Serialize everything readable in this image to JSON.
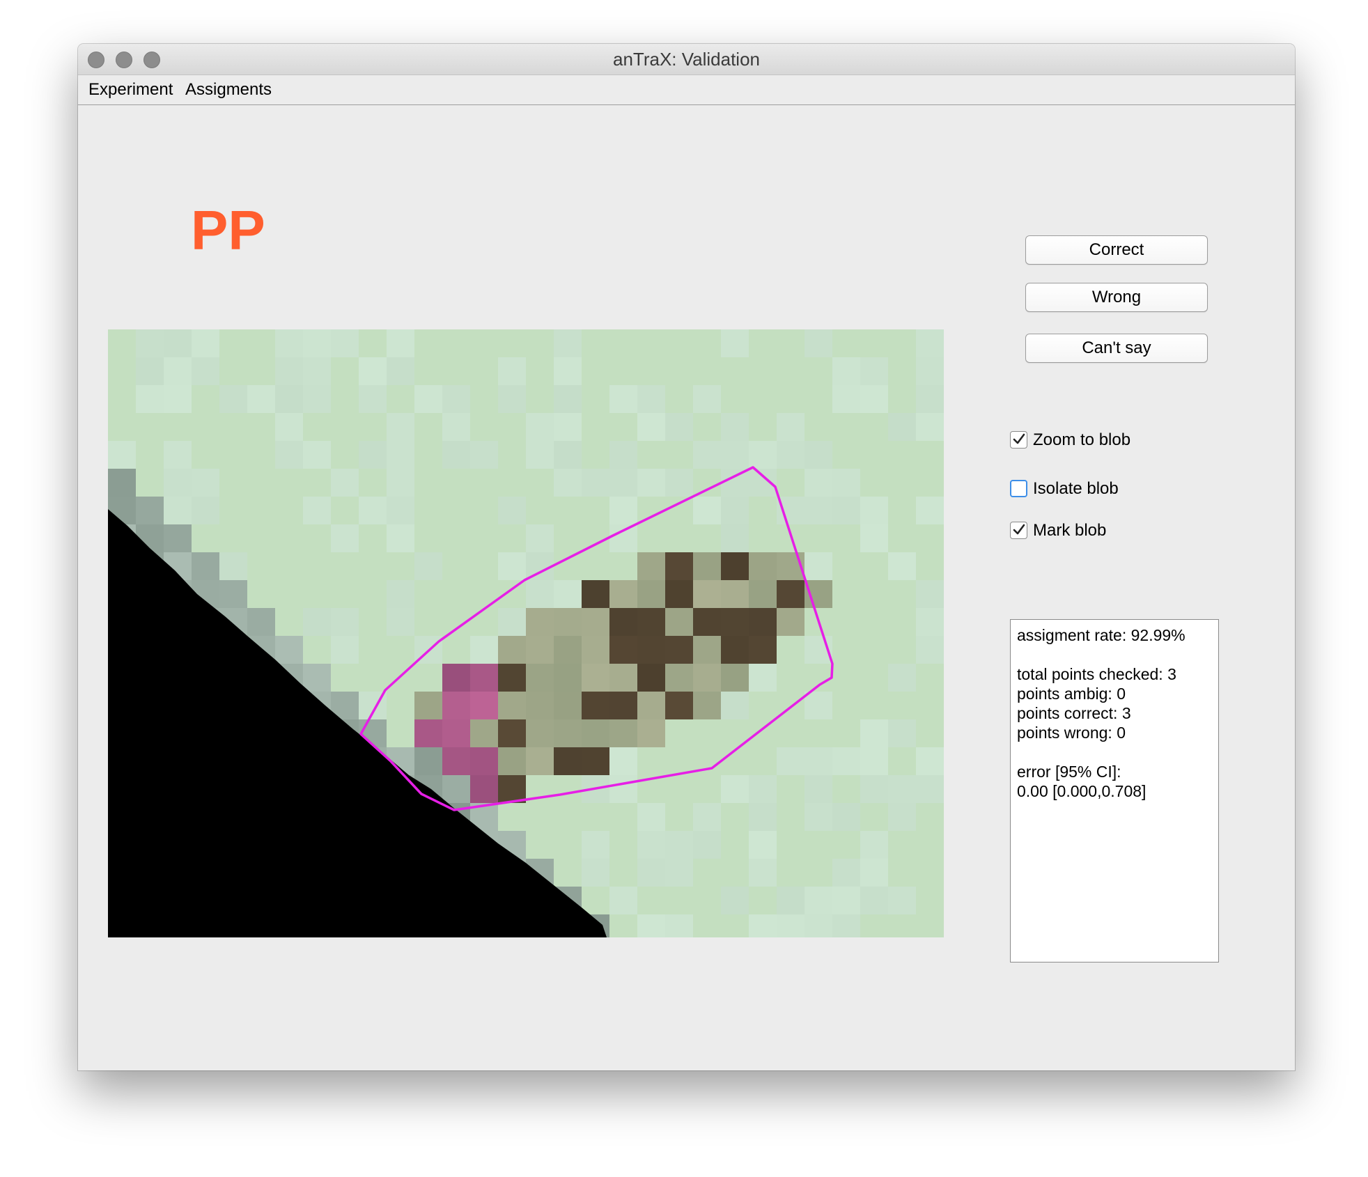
{
  "window": {
    "title": "anTraX: Validation"
  },
  "menu": {
    "items": [
      {
        "label": "Experiment"
      },
      {
        "label": "Assigments"
      }
    ]
  },
  "id_label": {
    "text": "PP",
    "color": "#ff5e2e"
  },
  "buttons": {
    "correct": "Correct",
    "wrong": "Wrong",
    "cant_say": "Can't say"
  },
  "options": [
    {
      "label": "Zoom to blob",
      "checked": true
    },
    {
      "label": "Isolate blob",
      "checked": false
    },
    {
      "label": "Mark blob",
      "checked": true
    }
  ],
  "stats": {
    "lines": [
      "assigment rate: 92.99%",
      "",
      "total points checked: 3",
      "points ambig: 0",
      "points correct: 3",
      "points wrong: 0",
      "",
      "error [95% CI]:",
      "0.00 [0.000,0.708]"
    ]
  },
  "frame": {
    "background_color": "#c4dfc0",
    "outline_color": "#e61fe6",
    "shadow_color": "#000000"
  }
}
